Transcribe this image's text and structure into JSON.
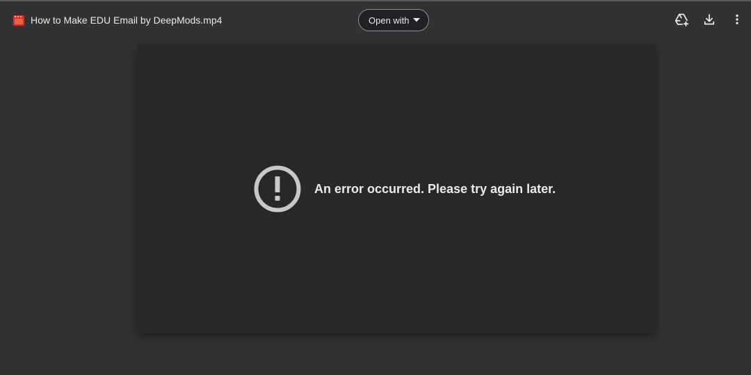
{
  "header": {
    "file_title": "How to Make EDU Email by DeepMods.mp4",
    "file_icon": "video-file-icon",
    "open_with_label": "Open with",
    "actions": [
      {
        "icon": "add-to-drive-icon"
      },
      {
        "icon": "download-icon"
      },
      {
        "icon": "more-vert-icon"
      }
    ]
  },
  "viewer": {
    "error_icon": "error-outline-icon",
    "error_message": "An error occurred. Please try again later."
  },
  "colors": {
    "background": "#323232",
    "viewer": "#282828",
    "file_icon": "#d93025",
    "text": "#e8eaed",
    "error_icon": "#c8c8c8"
  }
}
